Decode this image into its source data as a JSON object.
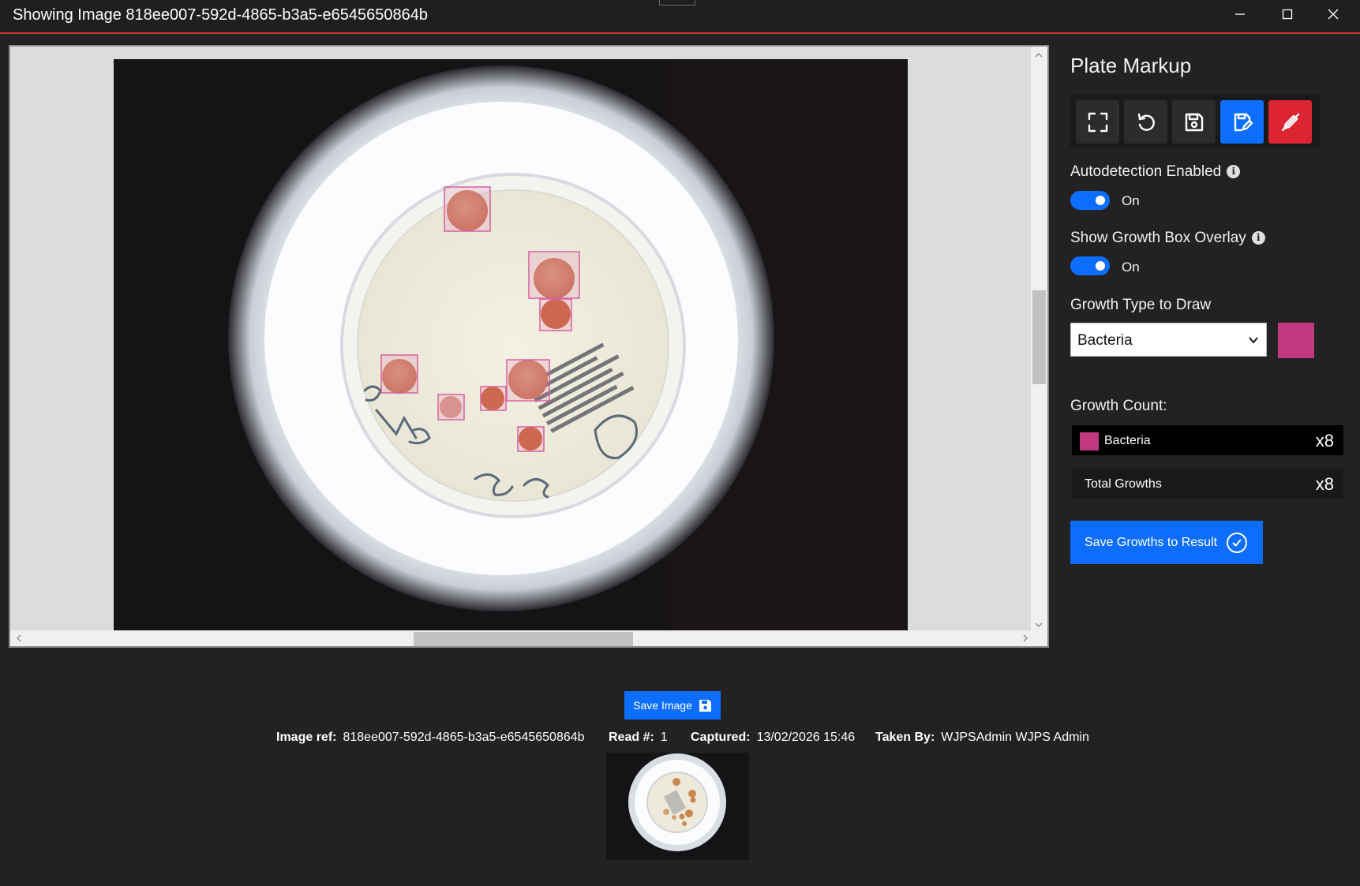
{
  "window": {
    "title": "Showing Image 818ee007-592d-4865-b3a5-e6545650864b",
    "controls": [
      "minimize-icon",
      "maximize-icon",
      "close-icon"
    ]
  },
  "viewer": {
    "image_kind": "agar plate photo",
    "growth_boxes_shown": 8,
    "scroll": {
      "vertical_thumb_fraction": 0.17,
      "horizontal_thumb_fraction": 0.22
    }
  },
  "panel": {
    "title": "Plate Markup",
    "toolbar": [
      {
        "icon": "fullscreen-icon",
        "style": "dark"
      },
      {
        "icon": "undo-icon",
        "style": "dark"
      },
      {
        "icon": "save-icon",
        "style": "dark"
      },
      {
        "icon": "edit-growth-icon",
        "style": "primary"
      },
      {
        "icon": "erase-growth-icon",
        "style": "danger"
      }
    ],
    "autodetection": {
      "label": "Autodetection Enabled",
      "state": "On"
    },
    "overlay": {
      "label": "Show Growth Box Overlay",
      "state": "On"
    },
    "growth_type": {
      "label": "Growth Type to Draw",
      "selected": "Bacteria",
      "color": "#c13a80"
    },
    "growth_count": {
      "label": "Growth Count:",
      "rows": [
        {
          "name": "Bacteria",
          "count": "x8",
          "color": "#c13a80"
        },
        {
          "name": "Total Growths",
          "count": "x8"
        }
      ]
    },
    "save_button": "Save Growths to Result"
  },
  "bottom": {
    "save_image": "Save Image",
    "image_ref_label": "Image ref:",
    "image_ref_value": "818ee007-592d-4865-b3a5-e6545650864b",
    "read_label": "Read #:",
    "read_value": "1",
    "captured_label": "Captured:",
    "captured_value": "13/02/2026 15:46",
    "taken_by_label": "Taken By:",
    "taken_by_value": "WJPSAdmin WJPS Admin"
  },
  "colors": {
    "primary": "#0d6efd",
    "danger": "#dc2433",
    "accent_line": "#c8342a",
    "background": "#222222"
  }
}
